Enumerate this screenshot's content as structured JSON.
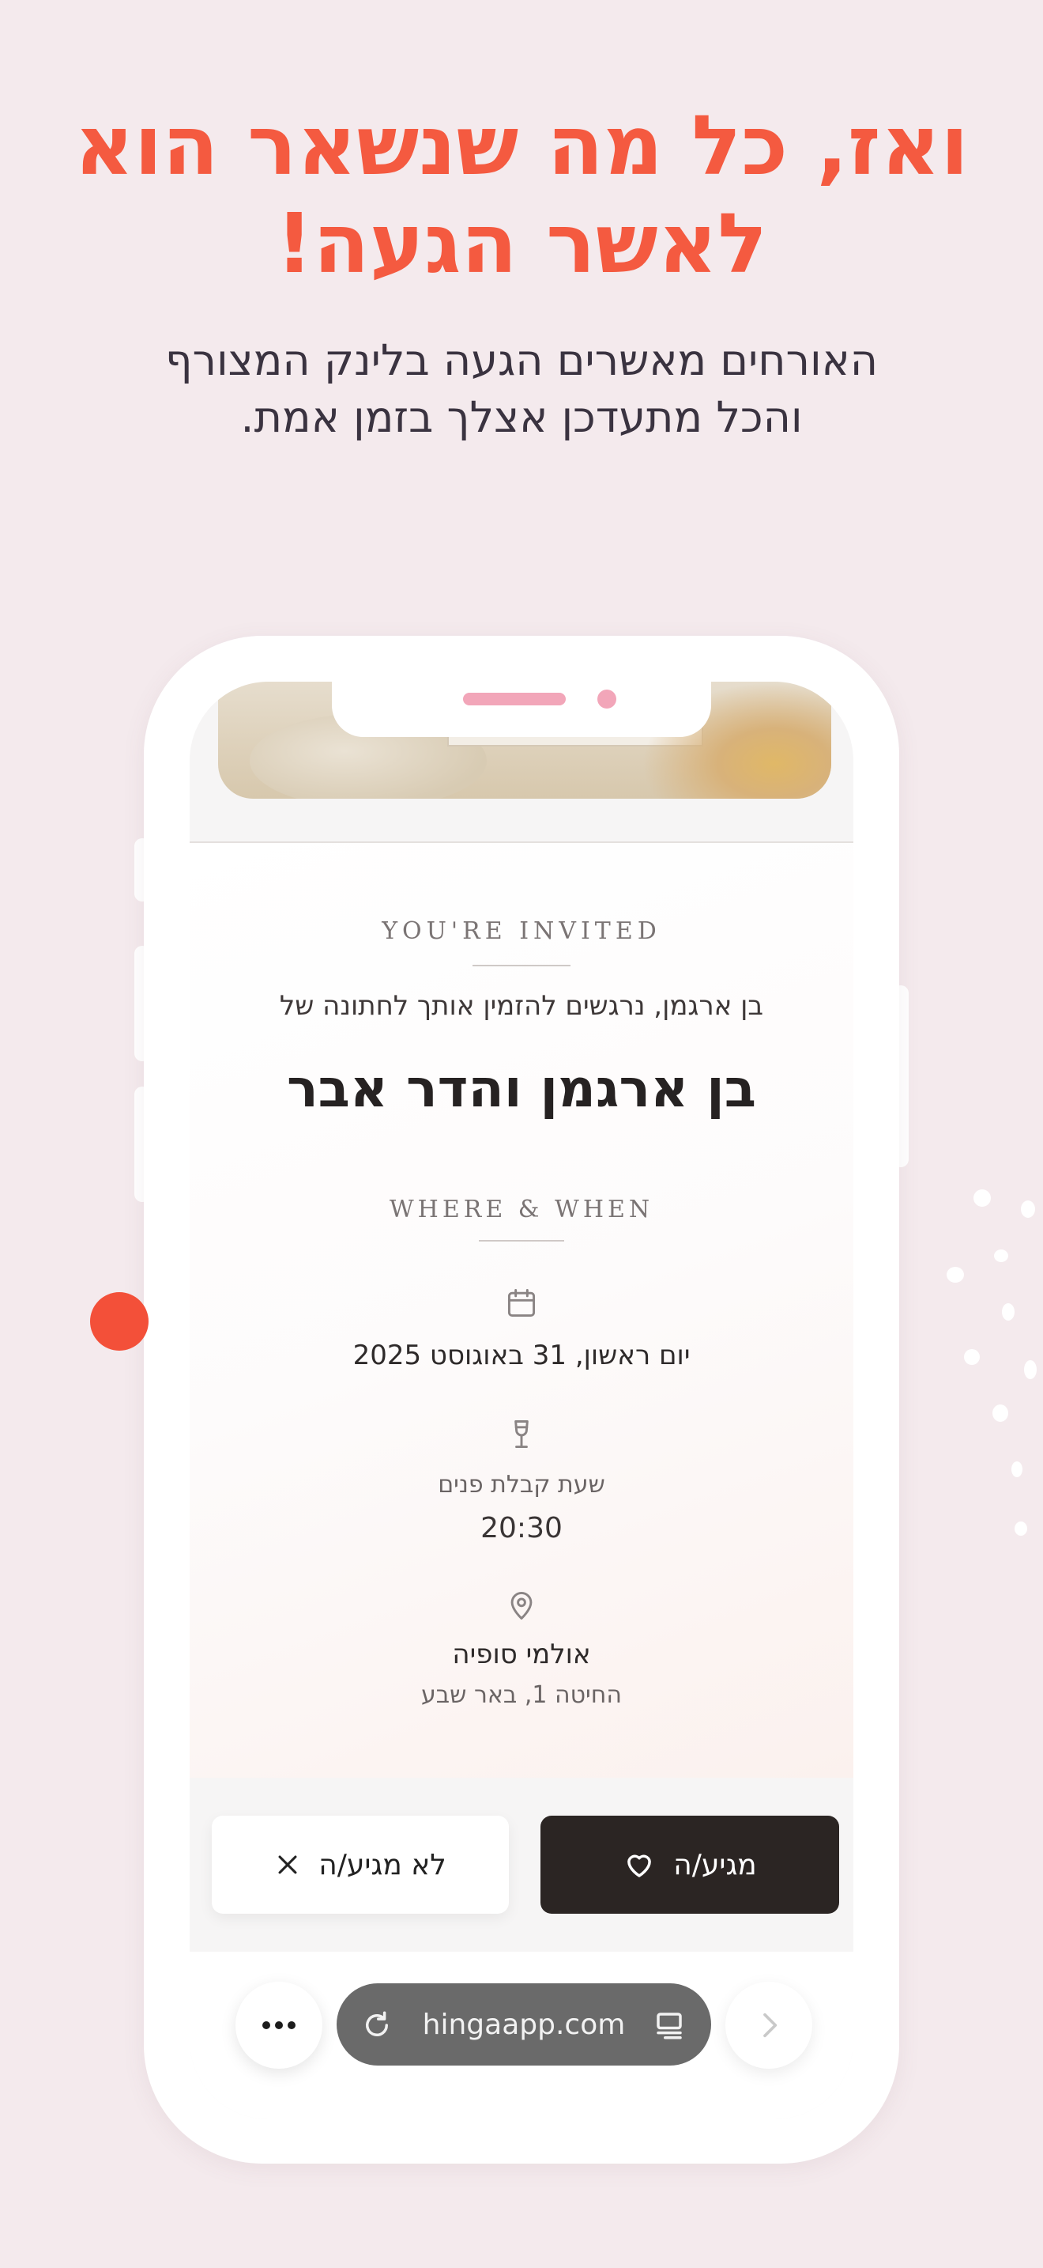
{
  "headline": {
    "line1": "ואז, כל מה שנשאר הוא",
    "line2": "לאשר הגעה!"
  },
  "subline": {
    "line1": "האורחים מאשרים הגעה בלינק המצורף",
    "line2": "והכל מתעדכן אצלך בזמן אמת."
  },
  "invitation": {
    "invited_label": "YOU'RE INVITED",
    "intro": "בן ארגמן, נרגשים להזמין אותך לחתונה של",
    "couple": "בן ארגמן והדר אבר",
    "where_when_label": "WHERE & WHEN",
    "date": "יום ראשון, 31 באוגוסט 2025",
    "reception_label": "שעת קבלת פנים",
    "reception_time": "20:30",
    "venue_name": "אולמי סופיה",
    "venue_address": "החיטה 1, באר שבע"
  },
  "rsvp": {
    "attending_label": "מגיע/ה",
    "not_attending_label": "לא מגיע/ה"
  },
  "browser": {
    "url": "hingaapp.com"
  },
  "colors": {
    "accent": "#f45a40",
    "background": "#f4eaed",
    "button_dark": "#2b2523"
  }
}
